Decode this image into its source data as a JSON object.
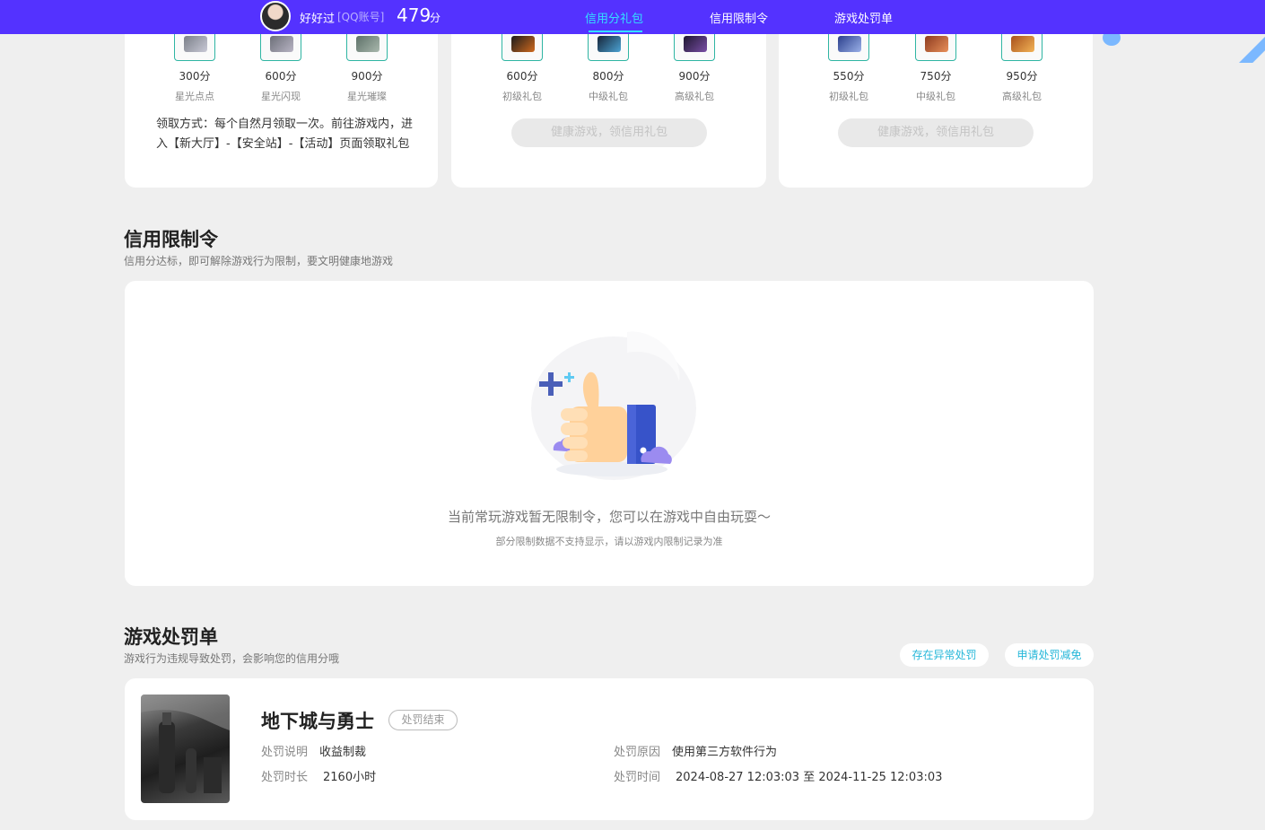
{
  "topbar": {
    "username": "好好过",
    "account_type": "[QQ账号]",
    "score": "479",
    "score_unit": "分",
    "tabs": [
      "信用分礼包",
      "信用限制令",
      "游戏处罚单"
    ],
    "active_tab": "信用分礼包",
    "accent": "#5432ff",
    "active_color": "#33e0ff"
  },
  "gift_cards": [
    {
      "items": [
        {
          "points": "300分",
          "name": "星光点点"
        },
        {
          "points": "600分",
          "name": "星光闪现"
        },
        {
          "points": "900分",
          "name": "星光璀璨"
        }
      ],
      "howto": "领取方式：每个自然月领取一次。前往游戏内，进入【新大厅】-【安全站】-【活动】页面领取礼包"
    },
    {
      "items": [
        {
          "points": "600分",
          "name": "初级礼包"
        },
        {
          "points": "800分",
          "name": "中级礼包"
        },
        {
          "points": "900分",
          "name": "高级礼包"
        }
      ],
      "button": "健康游戏，领信用礼包"
    },
    {
      "items": [
        {
          "points": "550分",
          "name": "初级礼包"
        },
        {
          "points": "750分",
          "name": "中级礼包"
        },
        {
          "points": "950分",
          "name": "高级礼包"
        }
      ],
      "button": "健康游戏，领信用礼包"
    }
  ],
  "restriction": {
    "title": "信用限制令",
    "subtitle": "信用分达标，即可解除游戏行为限制，要文明健康地游戏",
    "empty_text": "当前常玩游戏暂无限制令，您可以在游戏中自由玩耍～",
    "empty_sub": "部分限制数据不支持显示，请以游戏内限制记录为准"
  },
  "penalty": {
    "title": "游戏处罚单",
    "subtitle": "游戏行为违规导致处罚，会影响您的信用分哦",
    "btn_abnormal": "存在异常处罚",
    "btn_apply": "申请处罚减免",
    "record": {
      "game": "地下城与勇士",
      "status": "处罚结束",
      "desc_label": "处罚说明",
      "desc": "收益制裁",
      "duration_label": "处罚时长",
      "duration": "2160小时",
      "reason_label": "处罚原因",
      "reason": "使用第三方软件行为",
      "time_label": "处罚时间",
      "time": "2024-08-27 12:03:03 至 2024-11-25 12:03:03"
    }
  }
}
